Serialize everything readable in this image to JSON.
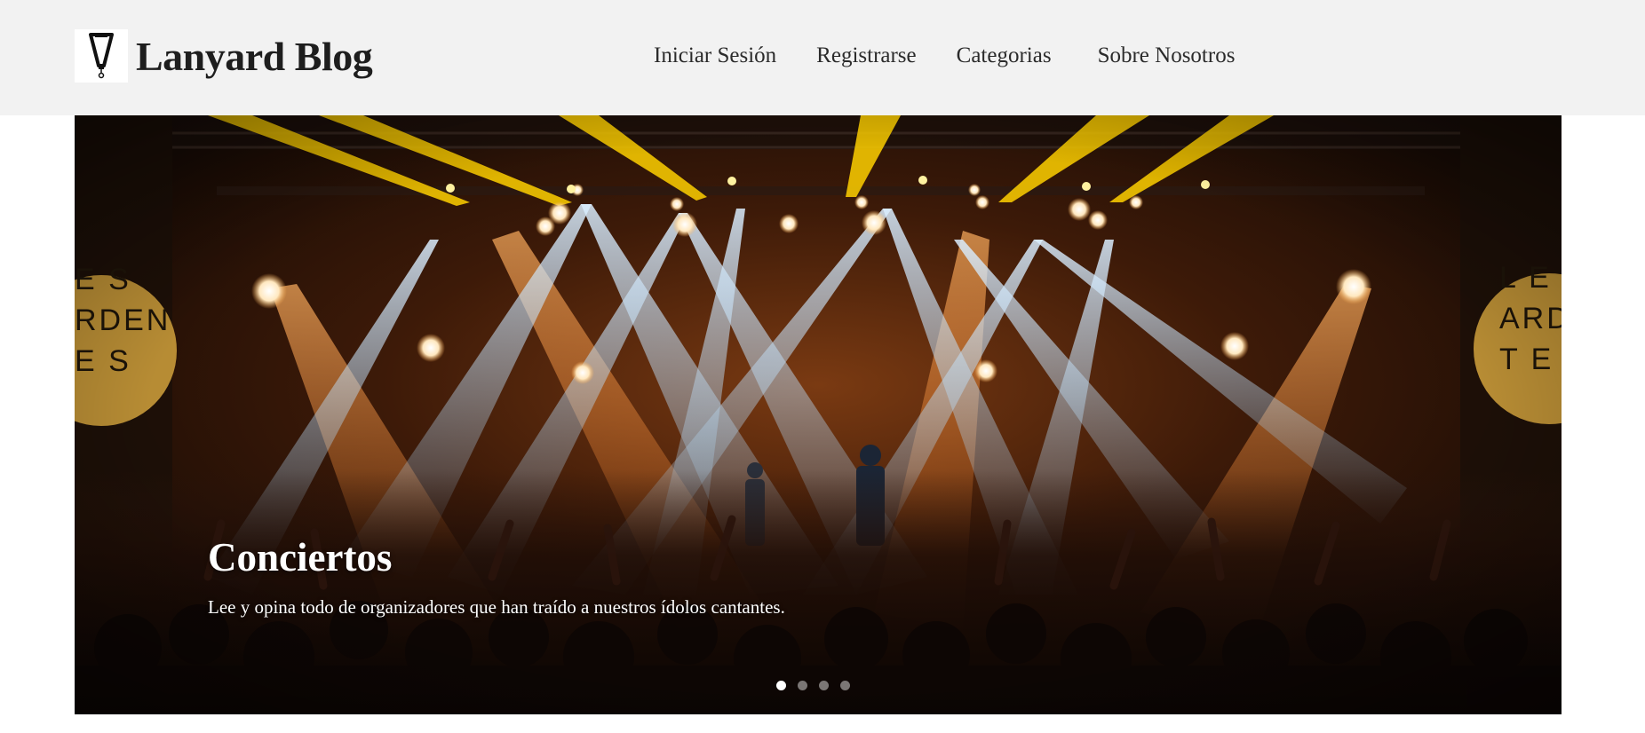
{
  "brand": {
    "title": "Lanyard Blog",
    "logo_icon": "lanyard-icon"
  },
  "nav": {
    "items": [
      {
        "label": "Iniciar Sesión"
      },
      {
        "label": "Registrarse"
      },
      {
        "label": "Categorias"
      },
      {
        "label": "Sobre Nosotros"
      }
    ]
  },
  "carousel": {
    "slide": {
      "title": "Conciertos",
      "text": "Lee y opina todo de organizadores que han traído a nuestros ídolos cantantes.",
      "image_subject": "concert-stage-lights-photo"
    },
    "banner_left_text": [
      "E S",
      "RDEN",
      "E S"
    ],
    "banner_right_text": [
      "L E",
      "ARD",
      "T E"
    ],
    "slide_count": 4,
    "active_index": 0
  },
  "colors": {
    "header_bg": "#f2f2f2",
    "brand_text": "#1e1e1e",
    "nav_text": "#2b2b2b",
    "caption_text": "#ffffff"
  }
}
